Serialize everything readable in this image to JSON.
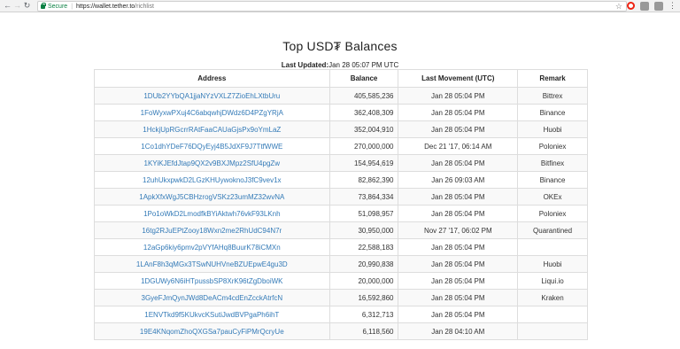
{
  "browser": {
    "secure_label": "Secure",
    "url_host": "https://wallet.tether.to",
    "url_path": "/richlist"
  },
  "page": {
    "title": "Top USD₮ Balances",
    "updated_label": "Last Updated:",
    "updated_value": "Jan 28 05:07 PM UTC"
  },
  "table": {
    "headers": [
      "Address",
      "Balance",
      "Last Movement (UTC)",
      "Remark"
    ],
    "rows": [
      [
        "1DUb2YYbQA1jjaNYzVXLZ7ZioEhLXtbUru",
        "405,585,236",
        "Jan 28 05:04 PM",
        "Bittrex"
      ],
      [
        "1FoWyxwPXuj4C6abqwhjDWdz6D4PZgYRjA",
        "362,408,309",
        "Jan 28 05:04 PM",
        "Binance"
      ],
      [
        "1HckjUpRGcrrRAtFaaCAUaGjsPx9oYmLaZ",
        "352,004,910",
        "Jan 28 05:04 PM",
        "Huobi"
      ],
      [
        "1Co1dhYDeF76DQyEyj4B5JdXF9J7TtfWWE",
        "270,000,000",
        "Dec 21 '17, 06:14 AM",
        "Poloniex"
      ],
      [
        "1KYiKJEfdJtap9QX2v9BXJMpz2SfU4pgZw",
        "154,954,619",
        "Jan 28 05:04 PM",
        "Bitfinex"
      ],
      [
        "12uhUkxpwkD2LGzKHUywoknoJ3fC9vev1x",
        "82,862,390",
        "Jan 26 09:03 AM",
        "Binance"
      ],
      [
        "1ApkXfxWgJ5CBHzrogVSKz23umMZ32wvNA",
        "73,864,334",
        "Jan 28 05:04 PM",
        "OKEx"
      ],
      [
        "1Po1oWkD2LmodfkBYiAktwh76vkF93LKnh",
        "51,098,957",
        "Jan 28 05:04 PM",
        "Poloniex"
      ],
      [
        "16tg2RJuEPtZooy18Wxn2me2RhUdC94N7r",
        "30,950,000",
        "Nov 27 '17, 06:02 PM",
        "Quarantined"
      ],
      [
        "12aGp6kiy6pmv2pVYfAHq8BuurK78iCMXn",
        "22,588,183",
        "Jan 28 05:04 PM",
        ""
      ],
      [
        "1LAnF8h3qMGx3TSwNUHVneBZUEpwE4gu3D",
        "20,990,838",
        "Jan 28 05:04 PM",
        "Huobi"
      ],
      [
        "1DGUWy6N6iHTpussbSP8XrK96tZgDboiWK",
        "20,000,000",
        "Jan 28 05:04 PM",
        "Liqui.io"
      ],
      [
        "3GyeFJmQynJWd8DeACm4cdEnZcckAtrfcN",
        "16,592,860",
        "Jan 28 05:04 PM",
        "Kraken"
      ],
      [
        "1ENVTkd9f5KUkvcKSutiJwdBVPgaPh6ihT",
        "6,312,713",
        "Jan 28 05:04 PM",
        ""
      ],
      [
        "19E4KNqomZhoQXGSa7pauCyFiPMrQcryUe",
        "6,118,560",
        "Jan 28 04:10 AM",
        ""
      ]
    ]
  }
}
